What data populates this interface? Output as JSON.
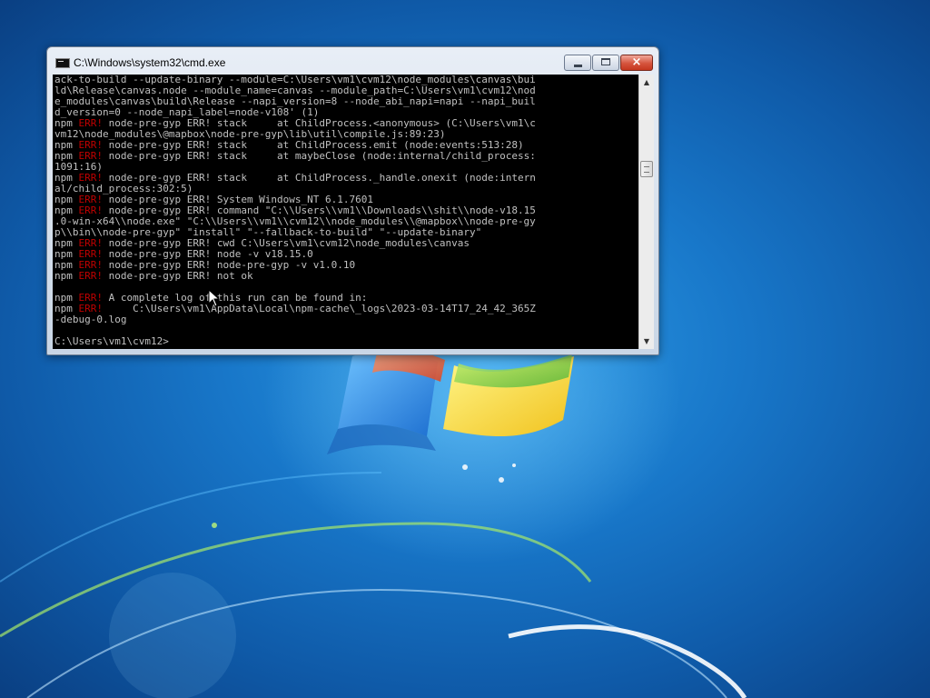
{
  "window": {
    "title": "C:\\Windows\\system32\\cmd.exe",
    "buttons": {
      "close_glyph": "×"
    }
  },
  "console": {
    "lines": [
      [
        {
          "t": "ack-to-build --update-binary --module=C:\\Users\\vm1\\cvm12\\node_modules\\canvas\\bui"
        }
      ],
      [
        {
          "t": "ld\\Release\\canvas.node --module_name=canvas --module_path=C:\\Users\\vm1\\cvm12\\nod"
        }
      ],
      [
        {
          "t": "e_modules\\canvas\\build\\Release --napi_version=8 --node_abi_napi=napi --napi_buil"
        }
      ],
      [
        {
          "t": "d_version=0 --node_napi_label=node-v108' (1)"
        }
      ],
      [
        {
          "t": "npm "
        },
        {
          "t": "ERR!",
          "err": true
        },
        {
          "t": " node-pre-gyp ERR! stack     at ChildProcess.<anonymous> (C:\\Users\\vm1\\c"
        }
      ],
      [
        {
          "t": "vm12\\node_modules\\@mapbox\\node-pre-gyp\\lib\\util\\compile.js:89:23)"
        }
      ],
      [
        {
          "t": "npm "
        },
        {
          "t": "ERR!",
          "err": true
        },
        {
          "t": " node-pre-gyp ERR! stack     at ChildProcess.emit (node:events:513:28)"
        }
      ],
      [
        {
          "t": "npm "
        },
        {
          "t": "ERR!",
          "err": true
        },
        {
          "t": " node-pre-gyp ERR! stack     at maybeClose (node:internal/child_process:"
        }
      ],
      [
        {
          "t": "1091:16)"
        }
      ],
      [
        {
          "t": "npm "
        },
        {
          "t": "ERR!",
          "err": true
        },
        {
          "t": " node-pre-gyp ERR! stack     at ChildProcess._handle.onexit (node:intern"
        }
      ],
      [
        {
          "t": "al/child_process:302:5)"
        }
      ],
      [
        {
          "t": "npm "
        },
        {
          "t": "ERR!",
          "err": true
        },
        {
          "t": " node-pre-gyp ERR! System Windows_NT 6.1.7601"
        }
      ],
      [
        {
          "t": "npm "
        },
        {
          "t": "ERR!",
          "err": true
        },
        {
          "t": " node-pre-gyp ERR! command \"C:\\\\Users\\\\vm1\\\\Downloads\\\\shit\\\\node-v18.15"
        }
      ],
      [
        {
          "t": ".0-win-x64\\\\node.exe\" \"C:\\\\Users\\\\vm1\\\\cvm12\\\\node_modules\\\\@mapbox\\\\node-pre-gy"
        }
      ],
      [
        {
          "t": "p\\\\bin\\\\node-pre-gyp\" \"install\" \"--fallback-to-build\" \"--update-binary\""
        }
      ],
      [
        {
          "t": "npm "
        },
        {
          "t": "ERR!",
          "err": true
        },
        {
          "t": " node-pre-gyp ERR! cwd C:\\Users\\vm1\\cvm12\\node_modules\\canvas"
        }
      ],
      [
        {
          "t": "npm "
        },
        {
          "t": "ERR!",
          "err": true
        },
        {
          "t": " node-pre-gyp ERR! node -v v18.15.0"
        }
      ],
      [
        {
          "t": "npm "
        },
        {
          "t": "ERR!",
          "err": true
        },
        {
          "t": " node-pre-gyp ERR! node-pre-gyp -v v1.0.10"
        }
      ],
      [
        {
          "t": "npm "
        },
        {
          "t": "ERR!",
          "err": true
        },
        {
          "t": " node-pre-gyp ERR! not ok"
        }
      ],
      [
        {
          "t": ""
        }
      ],
      [
        {
          "t": "npm "
        },
        {
          "t": "ERR!",
          "err": true
        },
        {
          "t": " A complete log of this run can be found in:"
        }
      ],
      [
        {
          "t": "npm "
        },
        {
          "t": "ERR!",
          "err": true
        },
        {
          "t": "     C:\\Users\\vm1\\AppData\\Local\\npm-cache\\_logs\\2023-03-14T17_24_42_365Z"
        }
      ],
      [
        {
          "t": "-debug-0.log"
        }
      ],
      [
        {
          "t": ""
        }
      ],
      [
        {
          "t": "C:\\Users\\vm1\\cvm12>"
        }
      ]
    ]
  },
  "scrollbar": {
    "up_glyph": "▲",
    "down_glyph": "▼"
  },
  "colors": {
    "console_background": "#000000",
    "console_text": "#c0c0c0",
    "error_text": "#c00000",
    "desktop_blue": "#1877c9"
  },
  "icons": [
    "cmd-app-icon",
    "minimize-icon",
    "maximize-icon",
    "close-icon",
    "windows-logo",
    "mouse-cursor-icon"
  ]
}
